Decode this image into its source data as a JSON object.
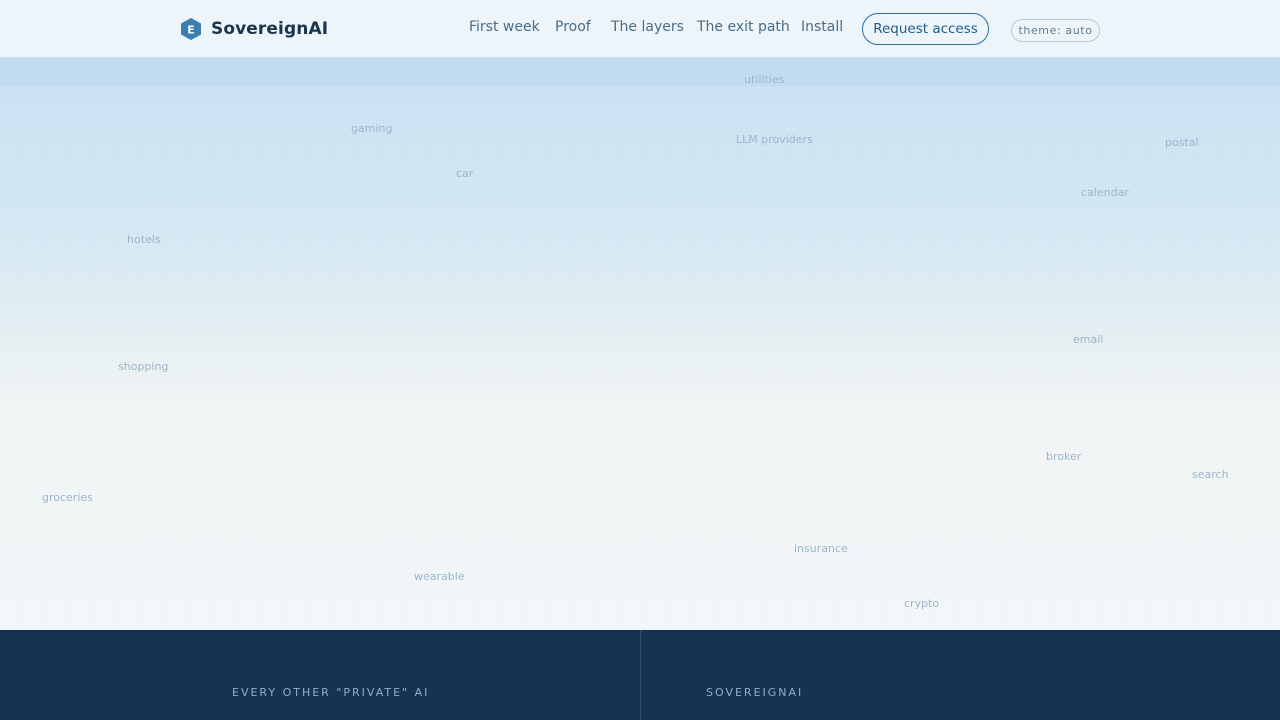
{
  "header": {
    "brand_name": "SovereignAI",
    "logo_letter": "E",
    "nav": [
      "First week",
      "Proof",
      "The layers",
      "The exit path",
      "Install"
    ],
    "cta_label": "Request access",
    "theme_label": "theme: auto"
  },
  "hero": {
    "floating_words": [
      "utilities",
      "gaming",
      "LLM providers",
      "postal",
      "car",
      "calendar",
      "hotels",
      "email",
      "shopping",
      "broker",
      "search",
      "groceries",
      "insurance",
      "wearable",
      "crypto"
    ]
  },
  "comparison": {
    "left_heading": "EVERY OTHER \"PRIVATE\" AI",
    "right_heading": "SOVEREIGNAI"
  },
  "colors": {
    "brand": "#2a6fa0",
    "logo": "#3b7fb0",
    "dark_band": "#163351"
  }
}
